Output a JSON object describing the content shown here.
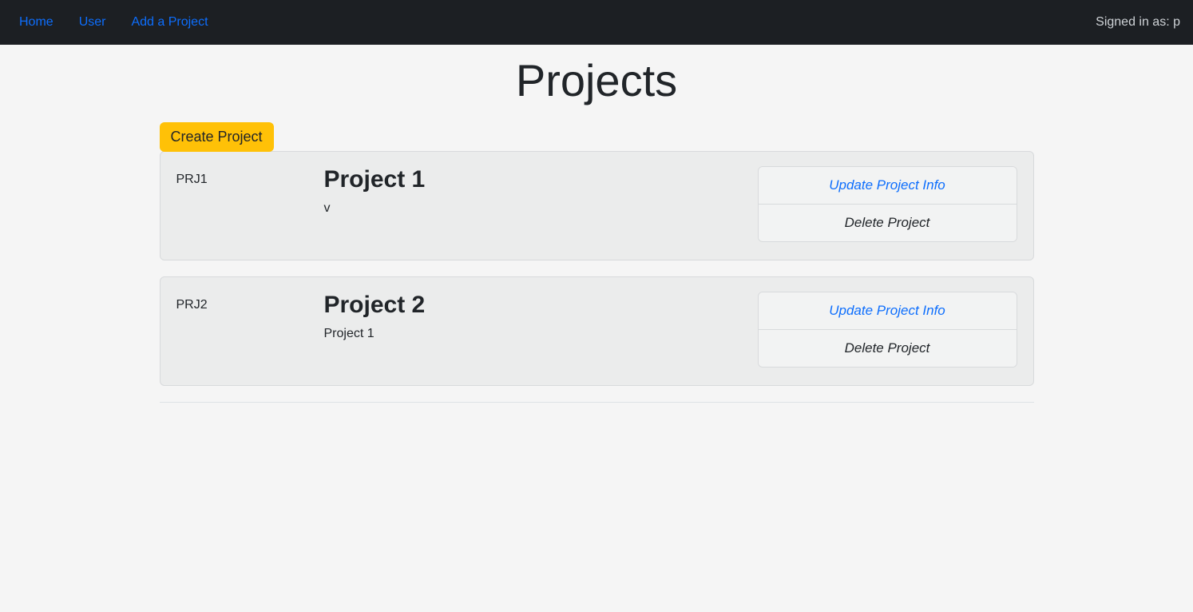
{
  "navbar": {
    "links": [
      {
        "label": "Home"
      },
      {
        "label": "User"
      },
      {
        "label": "Add a Project"
      }
    ],
    "signed_in_text": "Signed in as: p"
  },
  "page": {
    "title": "Projects"
  },
  "actions": {
    "create_project": "Create Project"
  },
  "projects": [
    {
      "code": "PRJ1",
      "name": "Project 1",
      "description": "v",
      "update_label": "Update Project Info",
      "delete_label": "Delete Project"
    },
    {
      "code": "PRJ2",
      "name": "Project 2",
      "description": "Project 1",
      "update_label": "Update Project Info",
      "delete_label": "Delete Project"
    }
  ]
}
